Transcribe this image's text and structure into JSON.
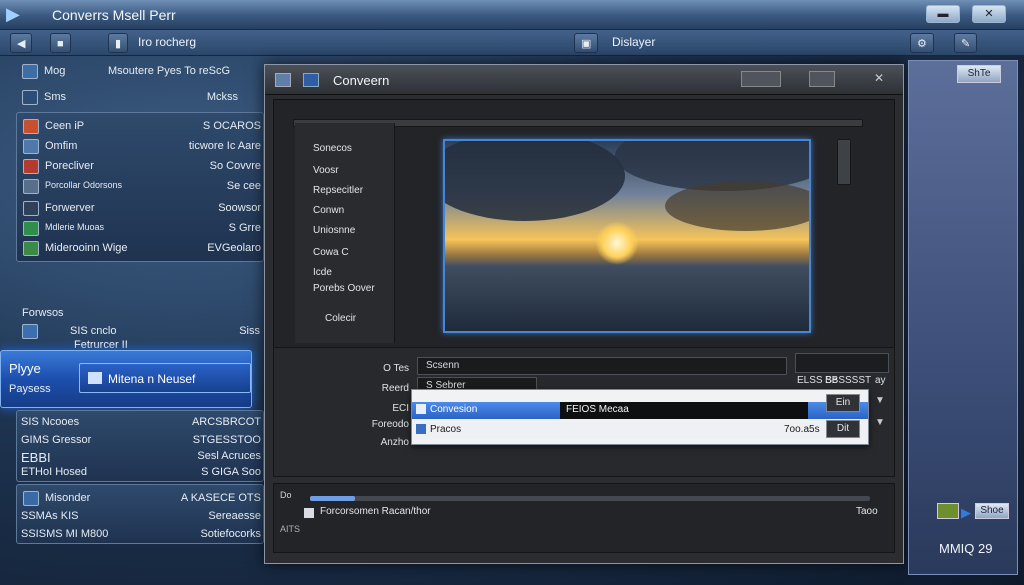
{
  "window": {
    "title": "Converrs Msell Perr",
    "minimize_label": "",
    "close_label": ""
  },
  "toolbar": {
    "center_label": "Iro rocherg",
    "right_label": "Dislayer"
  },
  "sidebar": {
    "header_left": "Mog",
    "header_right": "Msoutere Pyes To reScG",
    "subheader_left": "Sms",
    "subheader_right": "Mckss",
    "group1": [
      {
        "label": "Ceen iP",
        "value": "S OCAROS"
      },
      {
        "label": "Omfim",
        "value": "ticwore Ic Aare"
      },
      {
        "label": "Porecliver",
        "value": "So Covvre"
      },
      {
        "label": "Porcollar Odorsons",
        "value": "Se cee"
      },
      {
        "label": "Forwerver",
        "value": "Soowsor"
      },
      {
        "label": "Mdlerie Muoas",
        "value": "S Grre"
      },
      {
        "label": "Miderooinn Wige",
        "value": "EVGeolaro"
      }
    ],
    "section_label": "Forwsos",
    "row_a_left": "SIS cnclo",
    "row_a_right": "Siss",
    "row_b_left": "Fetrurcer II",
    "player": {
      "label_top": "Plyye",
      "label_bottom": "Paysess",
      "button": "Mitena n Neusef"
    },
    "group2": [
      {
        "label": "SIS Ncooes",
        "value": "ARCSBRCOT"
      },
      {
        "label": "GIMS Gressor",
        "value": "STGESSTOO"
      },
      {
        "label": "EBBI",
        "value": "Sesl Acruces"
      },
      {
        "label": "ETHoI Hosed",
        "value": "S GIGA Soo"
      }
    ],
    "group3": [
      {
        "label": "Misonder",
        "value": "A KASECE OTS"
      },
      {
        "label": "SSMAs KIS",
        "value": "Sereaesse"
      },
      {
        "label": "SSISMS MI M800",
        "value": "Sotiefocorks"
      }
    ]
  },
  "dialog": {
    "title": "Conveern",
    "list_items": [
      "Sonecos",
      "Voosr",
      "Repsecitler",
      "Conwn",
      "Uniosnne",
      "Cowa C",
      "Icde",
      "Porebs Oover",
      "Colecir"
    ],
    "form": {
      "field1_label": "O Tes",
      "field1_value": "Scsenn",
      "field2_label": "Reerd",
      "field2_value": "S Sebrer",
      "field3_label": "ECI",
      "field4_label": "Foreodo",
      "field5_label": "Anzho",
      "right_value_1": "ELSS Se",
      "right_value_2": "BBSSSST",
      "right_suffix": "ay"
    },
    "dropdown": {
      "options": [
        {
          "label": "Convesion",
          "extra": "FEIOS Mecaa"
        },
        {
          "label": "Pracos",
          "extra": "7oo.a5s"
        }
      ],
      "button_top": "Ein",
      "button_bottom": "Dit"
    },
    "footer": {
      "left_label": "Do",
      "status_text": "Forcorsomen Racan/thor",
      "right_label": "Taoo",
      "corner_label": "AITS",
      "progress": 0.08
    }
  },
  "right_panel": {
    "top_button": "ShTe",
    "bottom_button": "Shoe",
    "bottom_text": "MMIQ 29"
  },
  "colors": {
    "accent_blue": "#3a7ad8",
    "titlebar": "#4a6a94",
    "dialog_bg": "#2b2d31"
  }
}
